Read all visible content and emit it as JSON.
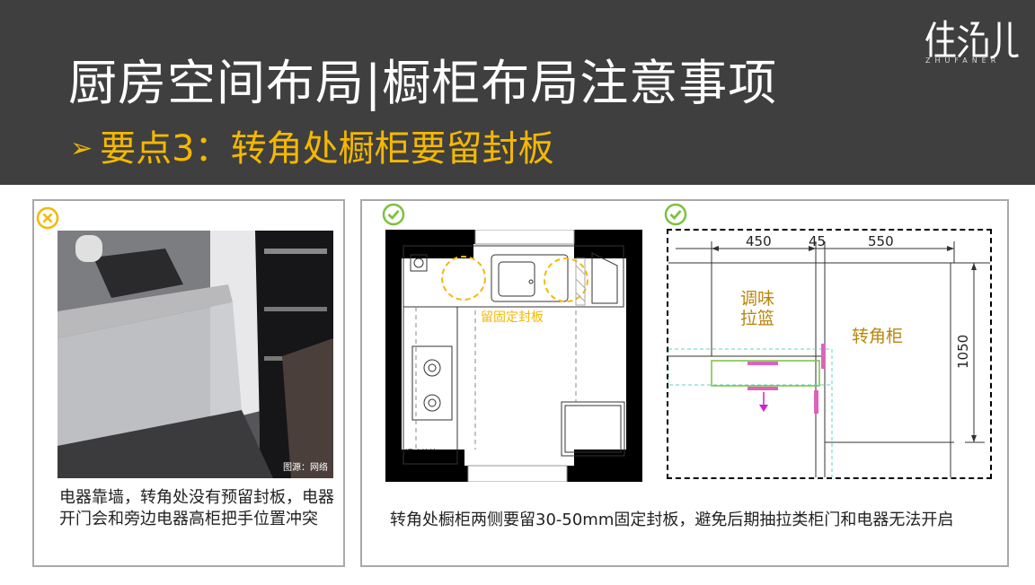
{
  "header": {
    "title": "厨房空间布局|橱柜布局注意事项",
    "subtitle_arrow": "➢",
    "subtitle": "要点3：转角处橱柜要留封板",
    "logo_text": "ZHUFANER",
    "logo_glyphs": "住范儿"
  },
  "left_panel": {
    "mark": "cross-circle-icon",
    "photo_credit": "图源：网络",
    "caption": "电器靠墙，转角处没有预留封板，电器开门会和旁边电器高柜把手位置冲突"
  },
  "right_panel": {
    "mark_1": "check-circle-icon",
    "mark_2": "check-circle-icon",
    "plan_label": "留固定封板",
    "plan_corner_label": "调味拉篮",
    "cad_dims": [
      "450",
      "45",
      "550"
    ],
    "cad_height": "1050",
    "cad_label_basket": "调味拉篮",
    "cad_label_corner": "转角柜",
    "caption": "转角处橱柜两侧要留30-50mm固定封板，避免后期抽拉类柜门和电器无法开启"
  },
  "colors": {
    "header_bg": "#3f3f3f",
    "accent": "#f5b800",
    "check": "#7cc142",
    "cross": "#f5b800",
    "cad_text": "#b8860b"
  }
}
